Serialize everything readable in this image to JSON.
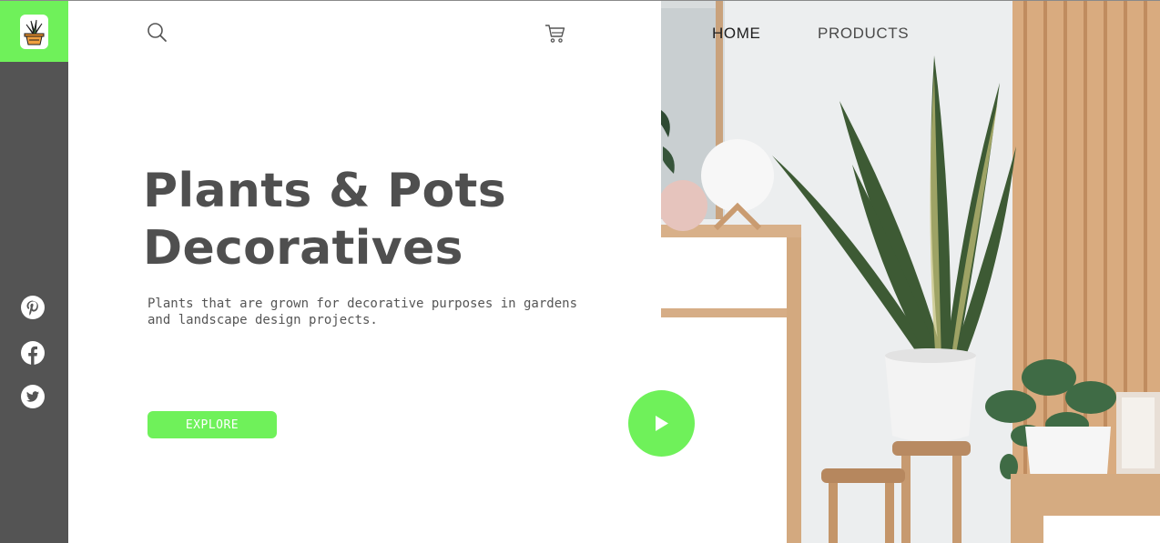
{
  "sidebar": {
    "logo_icon": "potted-plant-icon",
    "socials": [
      {
        "name": "pinterest",
        "icon": "pinterest-icon"
      },
      {
        "name": "facebook",
        "icon": "facebook-icon"
      },
      {
        "name": "twitter",
        "icon": "twitter-icon"
      }
    ]
  },
  "header": {
    "search_icon": "search-icon",
    "cart_icon": "cart-icon",
    "nav": {
      "home_label": "HOME",
      "products_label": "PRODUCTS"
    }
  },
  "hero": {
    "title_line1": "Plants & Pots",
    "title_line2": "Decoratives",
    "description": "Plants that are grown for decorative purposes in gardens and landscape design projects.",
    "cta_label": "EXPLORE",
    "play_icon": "play-icon"
  },
  "colors": {
    "accent": "#6ff15a",
    "sidebar": "#545454",
    "heading": "#4f4f4f",
    "body_text": "#555555"
  }
}
